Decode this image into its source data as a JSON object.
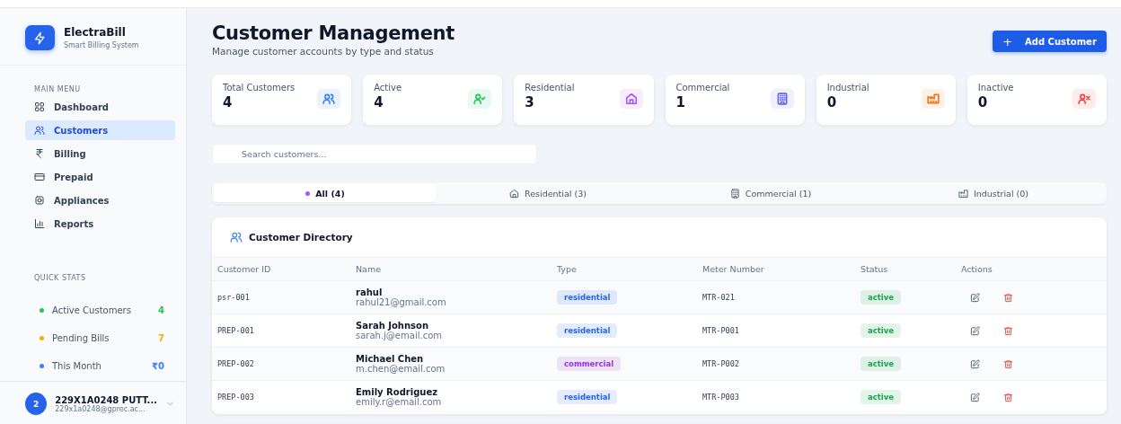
{
  "brand": {
    "name": "ElectraBill",
    "tagline": "Smart Billing System"
  },
  "menu": {
    "heading": "MAIN MENU",
    "items": [
      {
        "label": "Dashboard",
        "kind": "grid",
        "selected": false
      },
      {
        "label": "Customers",
        "kind": "users",
        "selected": true
      },
      {
        "label": "Billing",
        "kind": "rupee",
        "selected": false
      },
      {
        "label": "Prepaid",
        "kind": "card",
        "selected": false
      },
      {
        "label": "Appliances",
        "kind": "chip",
        "selected": false
      },
      {
        "label": "Reports",
        "kind": "chart",
        "selected": false
      }
    ]
  },
  "quick_stats": {
    "heading": "QUICK STATS",
    "items": [
      {
        "label": "Active Customers",
        "value": "4",
        "color": "#22c55e"
      },
      {
        "label": "Pending Bills",
        "value": "7",
        "color": "#eab308"
      },
      {
        "label": "This Month",
        "value": "₹0",
        "color": "#3b82f6"
      }
    ]
  },
  "user": {
    "avatar": "2",
    "name": "229X1A0248 PUTT...",
    "email": "229x1a0248@gprec.ac..."
  },
  "header": {
    "title": "Customer Management",
    "subtitle": "Manage customer accounts by type and status",
    "button": "Add Customer",
    "button_icon": "+"
  },
  "stats": [
    {
      "label": "Total Customers",
      "value": "4",
      "kind": "users",
      "color": "#3b82f6"
    },
    {
      "label": "Active",
      "value": "4",
      "kind": "user-check",
      "color": "#22c55e"
    },
    {
      "label": "Residential",
      "value": "3",
      "kind": "home",
      "color": "#a855f7"
    },
    {
      "label": "Commercial",
      "value": "1",
      "kind": "building",
      "color": "#6366f1"
    },
    {
      "label": "Industrial",
      "value": "0",
      "kind": "factory",
      "color": "#f97316"
    },
    {
      "label": "Inactive",
      "value": "0",
      "kind": "user-x",
      "color": "#ef4444"
    }
  ],
  "search": {
    "placeholder": "Search customers..."
  },
  "tabs": [
    {
      "label": "All (4)",
      "kind": "dot",
      "selected": true
    },
    {
      "label": "Residential (3)",
      "kind": "home",
      "selected": false
    },
    {
      "label": "Commercial (1)",
      "kind": "building",
      "selected": false
    },
    {
      "label": "Industrial (0)",
      "kind": "factory",
      "selected": false
    }
  ],
  "table": {
    "title": "Customer Directory",
    "columns": [
      "Customer ID",
      "Name",
      "Type",
      "Meter Number",
      "Status",
      "Actions"
    ],
    "rows": [
      {
        "id": "psr-001",
        "name": "rahul",
        "email": "rahul21@gmail.com",
        "type": {
          "label": "residential",
          "color": "#2563eb"
        },
        "meter": "MTR-021",
        "status": {
          "label": "active",
          "color": "#16a34a"
        }
      },
      {
        "id": "PREP-001",
        "name": "Sarah Johnson",
        "email": "sarah.j@email.com",
        "type": {
          "label": "residential",
          "color": "#2563eb"
        },
        "meter": "MTR-P001",
        "status": {
          "label": "active",
          "color": "#16a34a"
        }
      },
      {
        "id": "PREP-002",
        "name": "Michael Chen",
        "email": "m.chen@email.com",
        "type": {
          "label": "commercial",
          "color": "#9333ea"
        },
        "meter": "MTR-P002",
        "status": {
          "label": "active",
          "color": "#16a34a"
        }
      },
      {
        "id": "PREP-003",
        "name": "Emily Rodriguez",
        "email": "emily.r@email.com",
        "type": {
          "label": "residential",
          "color": "#2563eb"
        },
        "meter": "MTR-P003",
        "status": {
          "label": "active",
          "color": "#16a34a"
        }
      }
    ]
  }
}
